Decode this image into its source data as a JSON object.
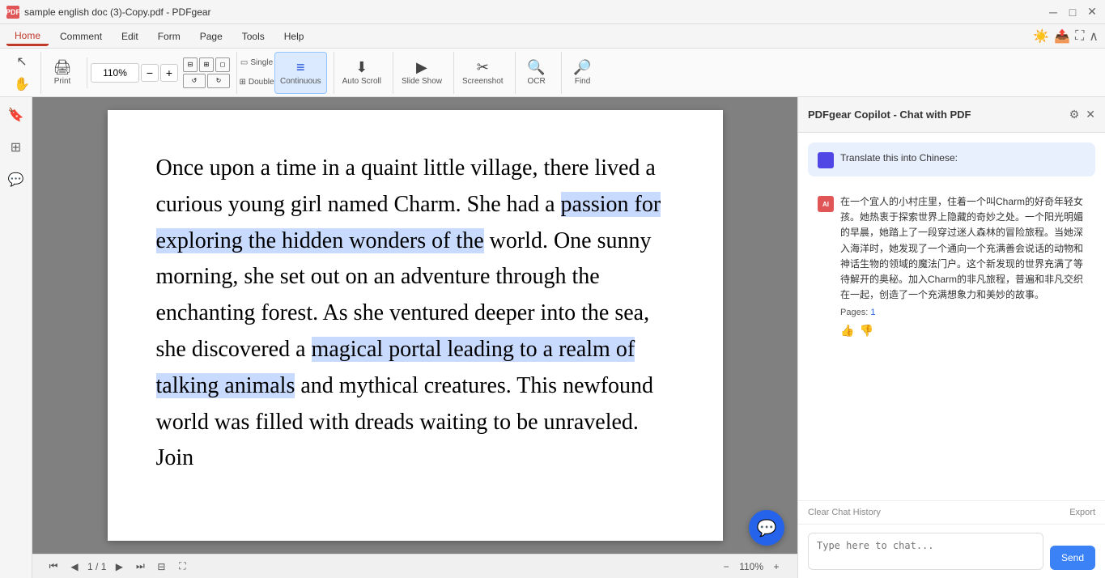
{
  "titlebar": {
    "icon_text": "PDF",
    "title": "sample english doc (3)-Copy.pdf - PDFgear",
    "minimize": "─",
    "maximize": "□",
    "close": "✕"
  },
  "menubar": {
    "items": [
      {
        "label": "Home",
        "active": true
      },
      {
        "label": "Comment",
        "active": false
      },
      {
        "label": "Edit",
        "active": false
      },
      {
        "label": "Form",
        "active": false
      },
      {
        "label": "Page",
        "active": false
      },
      {
        "label": "Tools",
        "active": false
      },
      {
        "label": "Help",
        "active": false
      }
    ]
  },
  "toolbar": {
    "zoom_value": "110%",
    "print_label": "Print",
    "single_label": "Single",
    "double_label": "Double",
    "continuous_label": "Continuous",
    "auto_scroll_label": "Auto Scroll",
    "slide_show_label": "Slide Show",
    "screenshot_label": "Screenshot",
    "ocr_label": "OCR",
    "find_label": "Find"
  },
  "pdf": {
    "paragraph": "Once upon a time in a quaint little village, there lived a curious young girl named Charm. She had a passion for exploring the hidden wonders of the world. One sunny morning, she set out on an adventure through the enchanting forest. As she ventured deeper into the sea, she discovered a magical portal leading to a realm of talking animals and mythical creatures. This newfound world was filled with dreads waiting to be unraveled. Join",
    "highlighted_phrase1": "passion for exploring the hidden wonders of the",
    "highlighted_phrase2": "magical portal leading to a realm of talking animals",
    "page_current": "1",
    "page_total": "1",
    "zoom_bottom": "110%"
  },
  "chat_panel": {
    "title": "PDFgear Copilot - Chat with PDF",
    "user_message": "Translate this into Chinese:",
    "ai_response": "在一个宜人的小村庄里，住着一个叫Charm的好奇年轻女孩。她热衷于探索世界上隐藏的奇妙之处。一个阳光明媚的早晨，她踏上了一段穿过迷人森林的冒险旅程。当她深入海洋时，她发现了一个通向一个充满善会说话的动物和神话生物的领域的魔法门户。这个新发现的世界充满了等待解开的奥秘。加入Charm的非凡旅程，普遍和非凡交织在一起，创造了一个充满想象力和美妙的故事。",
    "pages_label": "Pages:",
    "pages_num": "1",
    "clear_label": "Clear Chat History",
    "export_label": "Export",
    "input_placeholder": "Type here to chat...",
    "send_label": "Send"
  },
  "sidebar": {
    "icons": [
      {
        "name": "bookmark-icon",
        "symbol": "🔖"
      },
      {
        "name": "pages-icon",
        "symbol": "⊞"
      },
      {
        "name": "comment-icon",
        "symbol": "💬"
      }
    ]
  }
}
